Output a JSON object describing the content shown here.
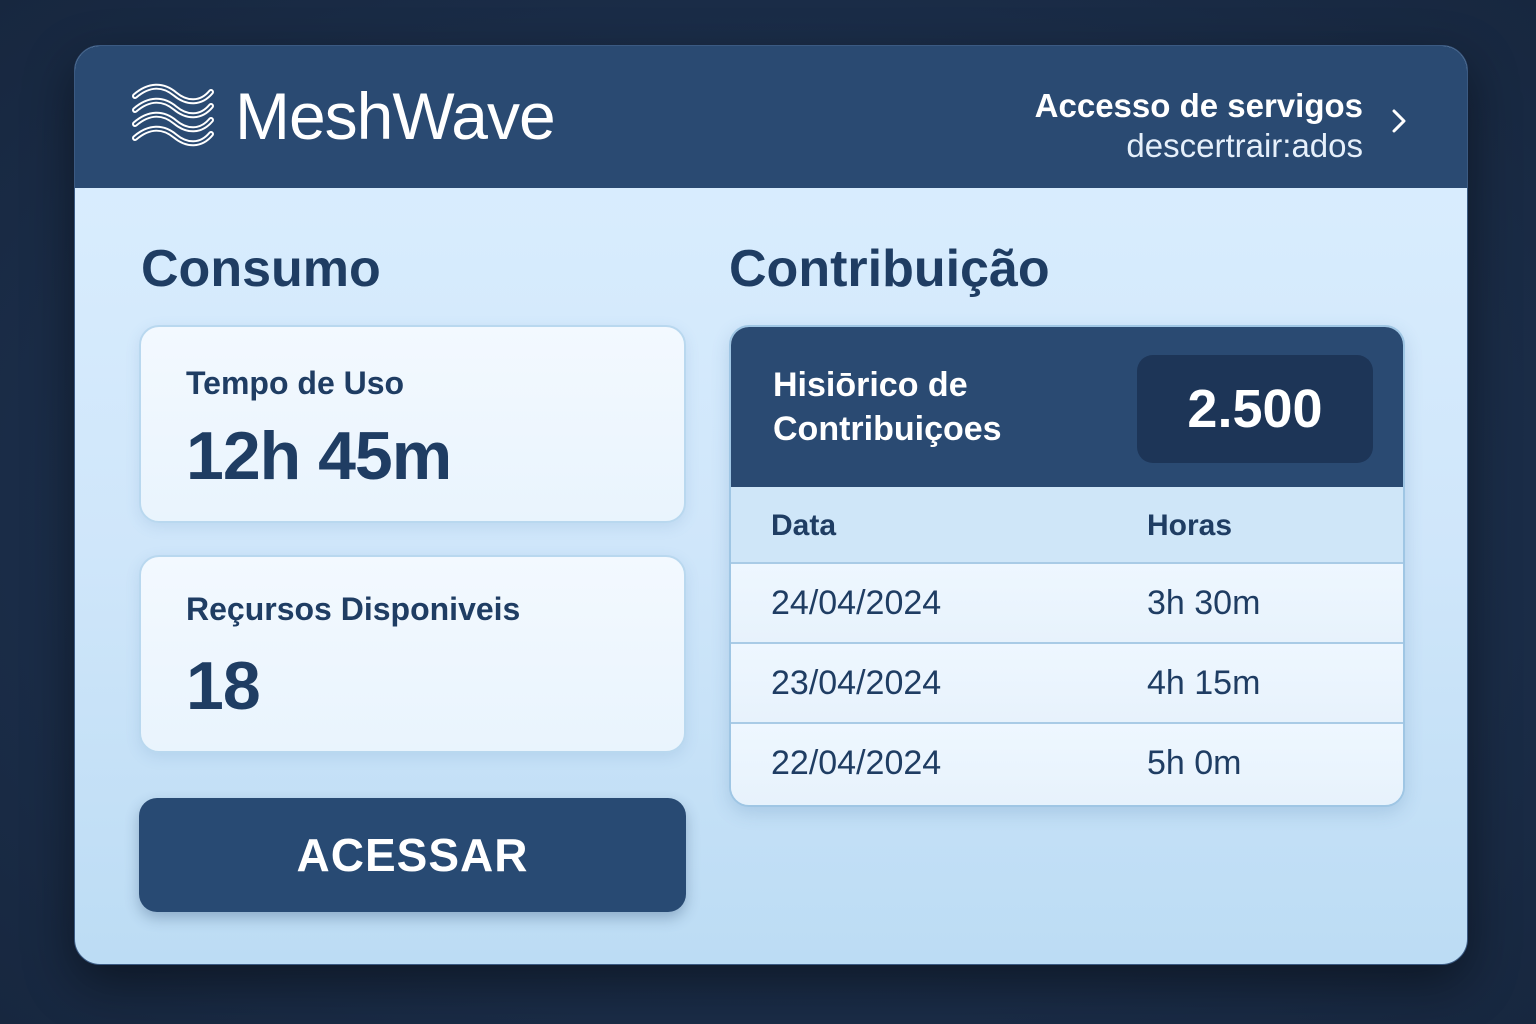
{
  "app": {
    "brand": "MeshWave",
    "header_link_line1": "Accesso de servigos",
    "header_link_line2": "descertrair:ados"
  },
  "icons": {
    "logo": "waves-logo-icon",
    "header_link": "chevron-right-icon"
  },
  "consumo": {
    "title": "Consumo",
    "tempo_label": "Tempo de Uso",
    "tempo_value": "12h 45m",
    "recursos_label": "Reçursos Disponiveis",
    "recursos_value": "18",
    "button_label": "ACESSAR"
  },
  "contribuicao": {
    "title": "Contribuição",
    "history_title_line1": "Hisiōrico de",
    "history_title_line2": "Contribuiçoes",
    "total": "2.500",
    "columns": [
      "Data",
      "Horas"
    ],
    "rows": [
      {
        "data": "24/04/2024",
        "horas": "3h 30m"
      },
      {
        "data": "23/04/2024",
        "horas": "4h 15m"
      },
      {
        "data": "22/04/2024",
        "horas": "5h 0m"
      }
    ]
  },
  "colors": {
    "header_bg": "#2a4a72",
    "accent_dark": "#1d3557",
    "text_primary": "#1f3d63",
    "card_bg": "#f3f9ff"
  }
}
